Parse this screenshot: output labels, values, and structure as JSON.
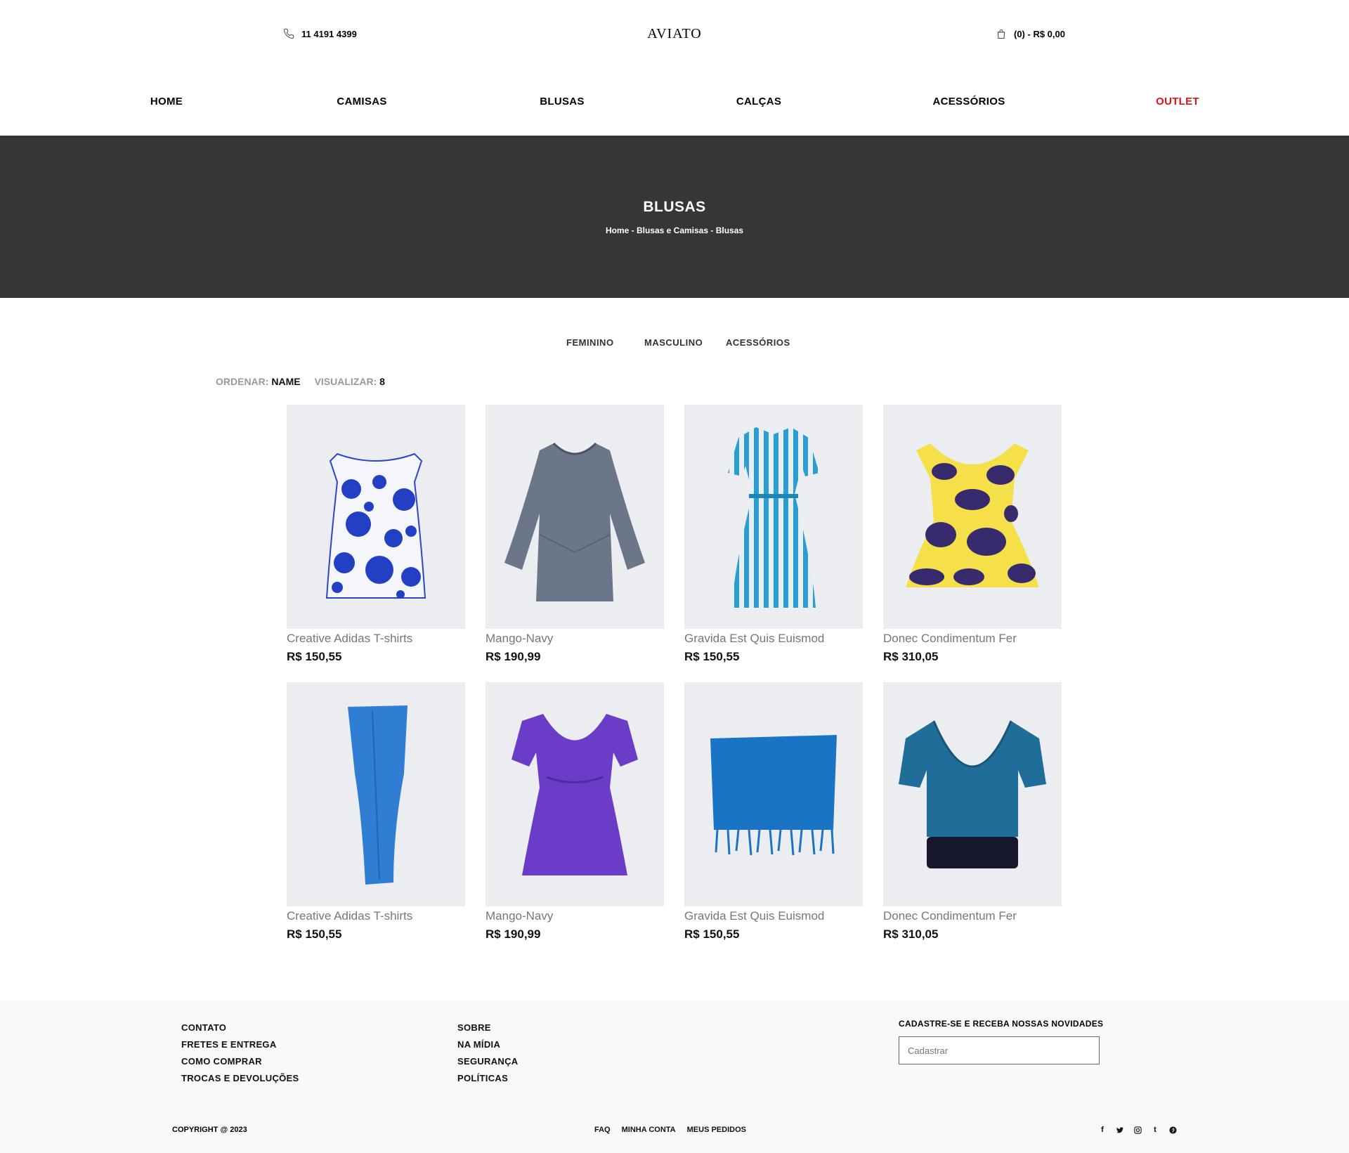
{
  "header": {
    "phone": "11 4191 4399",
    "logo": "AVIATO",
    "cart": "(0) - R$ 0,00"
  },
  "nav": {
    "home": "HOME",
    "camisas": "CAMISAS",
    "blusas": "BLUSAS",
    "calcas": "CALÇAS",
    "acessorios": "ACESSÓRIOS",
    "outlet": "OUTLET"
  },
  "banner": {
    "title": "BLUSAS",
    "crumb1": "Home",
    "crumb2": "Blusas e Camisas",
    "crumb3": "Blusas",
    "sep": " - "
  },
  "categories": {
    "feminino": "FEMININO",
    "masculino": "MASCULINO",
    "acessorios": "ACESSÓRIOS"
  },
  "toolbar": {
    "sort_label": "ORDENAR:",
    "sort_value": "NAME",
    "view_label": "VISUALIZAR:",
    "view_value": "8"
  },
  "products": [
    {
      "name": "Creative Adidas T-shirts",
      "price": "R$ 150,55",
      "image": "floral-blue-top"
    },
    {
      "name": "Mango-Navy",
      "price": "R$ 190,99",
      "image": "grey-tunic"
    },
    {
      "name": "Gravida Est Quis Euismod",
      "price": "R$ 150,55",
      "image": "striped-dress"
    },
    {
      "name": "Donec Condimentum Fer",
      "price": "R$ 310,05",
      "image": "yellow-purple-top"
    },
    {
      "name": "Creative Adidas T-shirts",
      "price": "R$ 150,55",
      "image": "blue-pants"
    },
    {
      "name": "Mango-Navy",
      "price": "R$ 190,99",
      "image": "purple-blouse"
    },
    {
      "name": "Gravida Est Quis Euismod",
      "price": "R$ 150,55",
      "image": "blue-scarf"
    },
    {
      "name": "Donec Condimentum Fer",
      "price": "R$ 310,05",
      "image": "teal-wrap-top"
    }
  ],
  "footer": {
    "col1": [
      "CONTATO",
      "FRETES E ENTREGA",
      "COMO COMPRAR",
      "TROCAS E DEVOLUÇÕES"
    ],
    "col2": [
      "SOBRE",
      "NA MÍDIA",
      "SEGURANÇA",
      "POLÍTICAS"
    ],
    "newsletter_title": "CADASTRE-SE E RECEBA NOSSAS NOVIDADES",
    "newsletter_placeholder": "Cadastrar",
    "copyright": "COPYRIGHT @ 2023",
    "links": [
      "FAQ",
      "MINHA CONTA",
      "MEUS PEDIDOS"
    ],
    "social": {
      "facebook": "f",
      "twitter": "t",
      "tumblr": "t"
    }
  },
  "colors": {
    "banner_bg": "#363636",
    "outlet": "#e11313",
    "footer_bg": "#f9f9f9",
    "product_bg": "#ecedf0"
  }
}
